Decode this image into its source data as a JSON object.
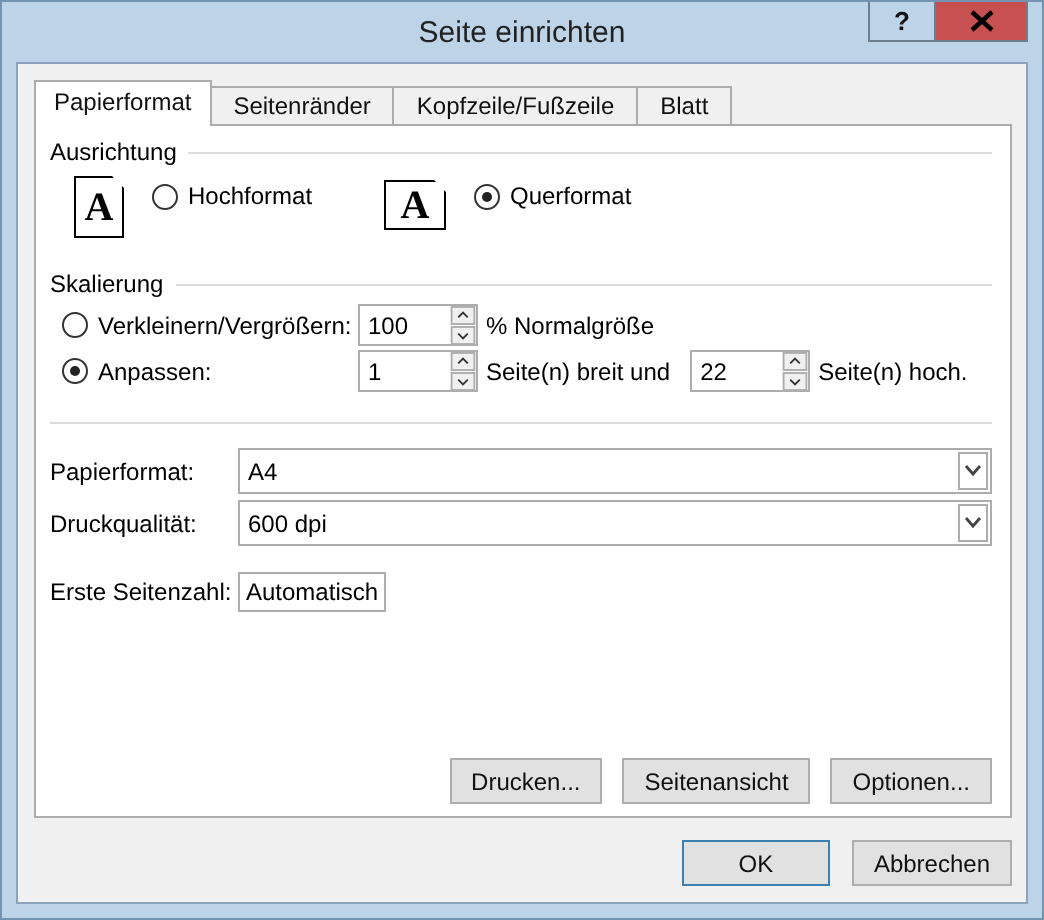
{
  "window": {
    "title": "Seite einrichten",
    "help": "?"
  },
  "tabs": [
    {
      "label": "Papierformat",
      "selected": true
    },
    {
      "label": "Seitenränder",
      "selected": false
    },
    {
      "label": "Kopfzeile/Fußzeile",
      "selected": false
    },
    {
      "label": "Blatt",
      "selected": false
    }
  ],
  "orientation": {
    "heading": "Ausrichtung",
    "options": [
      {
        "kind": "portrait",
        "glyph": "A",
        "label": "Hochformat",
        "selected": false
      },
      {
        "kind": "landscape",
        "glyph": "A",
        "label": "Querformat",
        "selected": true
      }
    ]
  },
  "scaling": {
    "heading": "Skalierung",
    "options": [
      {
        "label": "Verkleinern/Vergrößern:",
        "selected": false,
        "fields": [
          {
            "value": "100",
            "suffix": "% Normalgröße"
          }
        ]
      },
      {
        "label": "Anpassen:",
        "selected": true,
        "fields": [
          {
            "value": "1",
            "suffix": "Seite(n) breit und"
          },
          {
            "value": "22",
            "suffix": "Seite(n) hoch."
          }
        ]
      }
    ]
  },
  "selects": [
    {
      "label": "Papierformat:",
      "value": "A4"
    },
    {
      "label": "Druckqualität:",
      "value": "600 dpi"
    }
  ],
  "first_page": {
    "label": "Erste Seitenzahl:",
    "value": "Automatisch"
  },
  "panel_buttons": [
    "Drucken...",
    "Seitenansicht",
    "Optionen..."
  ],
  "dialog_buttons": [
    {
      "label": "OK",
      "default": true
    },
    {
      "label": "Abbrechen",
      "default": false
    }
  ]
}
